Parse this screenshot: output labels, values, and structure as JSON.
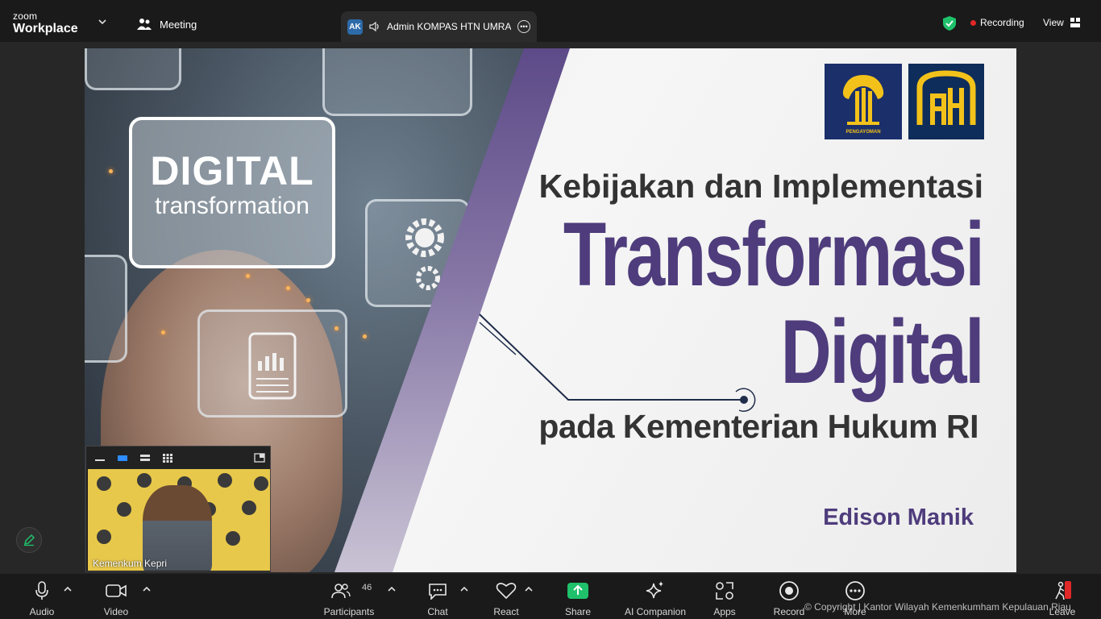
{
  "app": {
    "brand_small": "zoom",
    "brand_large": "Workplace",
    "meeting_label": "Meeting"
  },
  "speaker_tab": {
    "initials": "AK",
    "name": "Admin KOMPAS HTN UMRAH"
  },
  "status": {
    "recording_label": "Recording",
    "view_label": "View"
  },
  "slide": {
    "card_line1": "DIGITAL",
    "card_line2": "transformation",
    "logo1_caption": "PENGAYOMAN",
    "line1": "Kebijakan dan Implementasi",
    "line2": "Transformasi",
    "line3": "Digital",
    "line4": "pada Kementerian Hukum RI",
    "author": "Edison Manik"
  },
  "self_view": {
    "name": "Kemenkum Kepri"
  },
  "toolbar": {
    "audio": "Audio",
    "video": "Video",
    "participants": "Participants",
    "participants_count": "46",
    "chat": "Chat",
    "react": "React",
    "share": "Share",
    "ai_companion": "AI Companion",
    "apps": "Apps",
    "record": "Record",
    "more": "More",
    "leave": "Leave"
  },
  "watermark": "© Copyright | Kantor Wilayah Kemenkumham Kepulauan Riau",
  "colors": {
    "accent_purple": "#4e3c7c",
    "share_green": "#1fc16b",
    "recording_red": "#e02828",
    "logo_navy": "#1b2f6b",
    "logo_gold": "#f3c21a"
  },
  "icons": {
    "shield": "shield-check-icon",
    "audio": "microphone-icon",
    "video": "video-camera-icon",
    "participants": "people-icon",
    "chat": "chat-bubble-icon",
    "react": "heart-icon",
    "share": "share-arrow-icon",
    "ai": "sparkle-icon",
    "apps": "apps-icon",
    "record": "record-icon",
    "more": "more-dots-icon",
    "leave": "leave-icon"
  }
}
